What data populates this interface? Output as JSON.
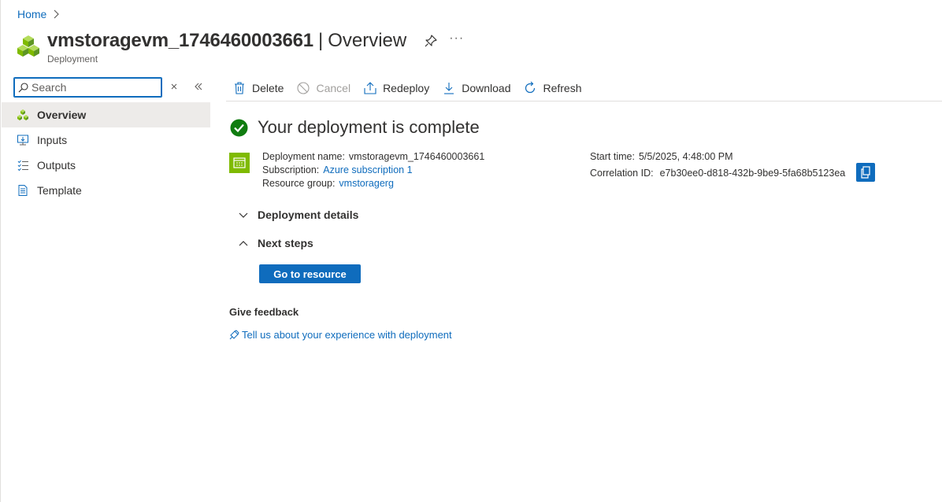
{
  "breadcrumb": {
    "home": "Home"
  },
  "header": {
    "title": "vmstoragevm_1746460003661",
    "separator": "|",
    "section": "Overview",
    "subtitle": "Deployment",
    "more": "···"
  },
  "sidebar": {
    "search_placeholder": "Search",
    "items": [
      {
        "label": "Overview",
        "icon": "deployment-icon"
      },
      {
        "label": "Inputs",
        "icon": "inputs-icon"
      },
      {
        "label": "Outputs",
        "icon": "outputs-icon"
      },
      {
        "label": "Template",
        "icon": "template-icon"
      }
    ]
  },
  "toolbar": {
    "delete": "Delete",
    "cancel": "Cancel",
    "redeploy": "Redeploy",
    "download": "Download",
    "refresh": "Refresh"
  },
  "main": {
    "status_title": "Your deployment is complete",
    "deployment_name_label": "Deployment name:",
    "deployment_name": "vmstoragevm_1746460003661",
    "subscription_label": "Subscription:",
    "subscription": "Azure subscription 1",
    "resource_group_label": "Resource group:",
    "resource_group": "vmstoragerg",
    "start_time_label": "Start time:",
    "start_time": "5/5/2025, 4:48:00 PM",
    "correlation_label": "Correlation ID:",
    "correlation_id": "e7b30ee0-d818-432b-9be9-5fa68b5123ea",
    "deployment_details": "Deployment details",
    "next_steps": "Next steps",
    "go_to_resource": "Go to resource",
    "feedback_title": "Give feedback",
    "feedback_link": "Tell us about your experience with deployment"
  },
  "colors": {
    "accent": "#0f6cbd",
    "success": "#107c10",
    "deployment_green": "#7fba00"
  }
}
